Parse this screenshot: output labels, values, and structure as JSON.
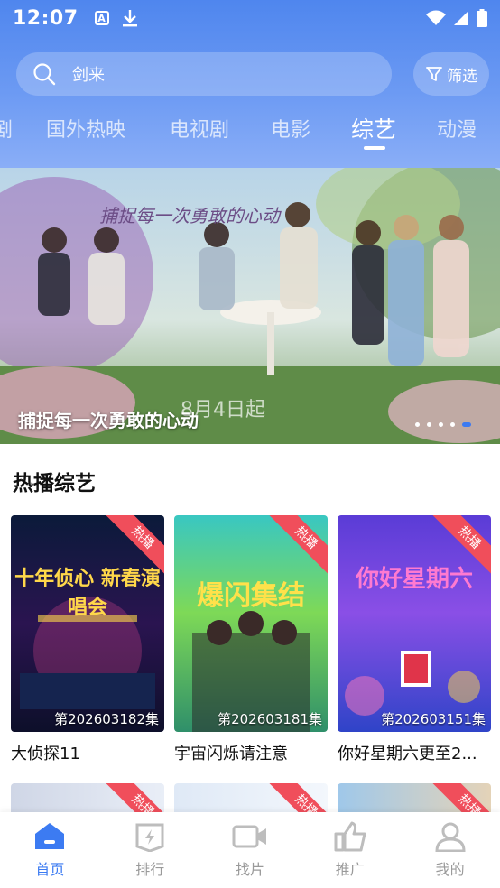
{
  "status_bar": {
    "time": "12:07",
    "a_badge": "A"
  },
  "search": {
    "query": "剑来",
    "filter_label": "筛选"
  },
  "tabs": [
    {
      "label": "剧"
    },
    {
      "label": "国外热映"
    },
    {
      "label": "电视剧"
    },
    {
      "label": "电影"
    },
    {
      "label": "综艺"
    },
    {
      "label": "动漫"
    }
  ],
  "banner": {
    "caption": "捕捉每一次勇敢的心动",
    "art_title": "捕捉每一次勇敢的心动",
    "art_date": "8月4日起"
  },
  "section": {
    "title": "热播综艺",
    "cards": [
      {
        "title": "大侦探11",
        "episode": "第202603182集",
        "badge": "热播",
        "poster_text": "十年侦心 新春演唱会"
      },
      {
        "title": "宇宙闪烁请注意",
        "episode": "第202603181集",
        "badge": "热播",
        "poster_text": "爆闪集结"
      },
      {
        "title": "你好星期六更至2...",
        "episode": "第202603151集",
        "badge": "热播",
        "poster_text": "你好星期六"
      }
    ],
    "row2_badges": [
      "热播",
      "热播",
      "热播"
    ]
  },
  "bottom_nav": [
    {
      "label": "首页"
    },
    {
      "label": "排行"
    },
    {
      "label": "找片"
    },
    {
      "label": "推广"
    },
    {
      "label": "我的"
    }
  ],
  "colors": {
    "accent": "#3c7bf2",
    "header": "#5a8ef0",
    "badge": "#f04e5b"
  }
}
